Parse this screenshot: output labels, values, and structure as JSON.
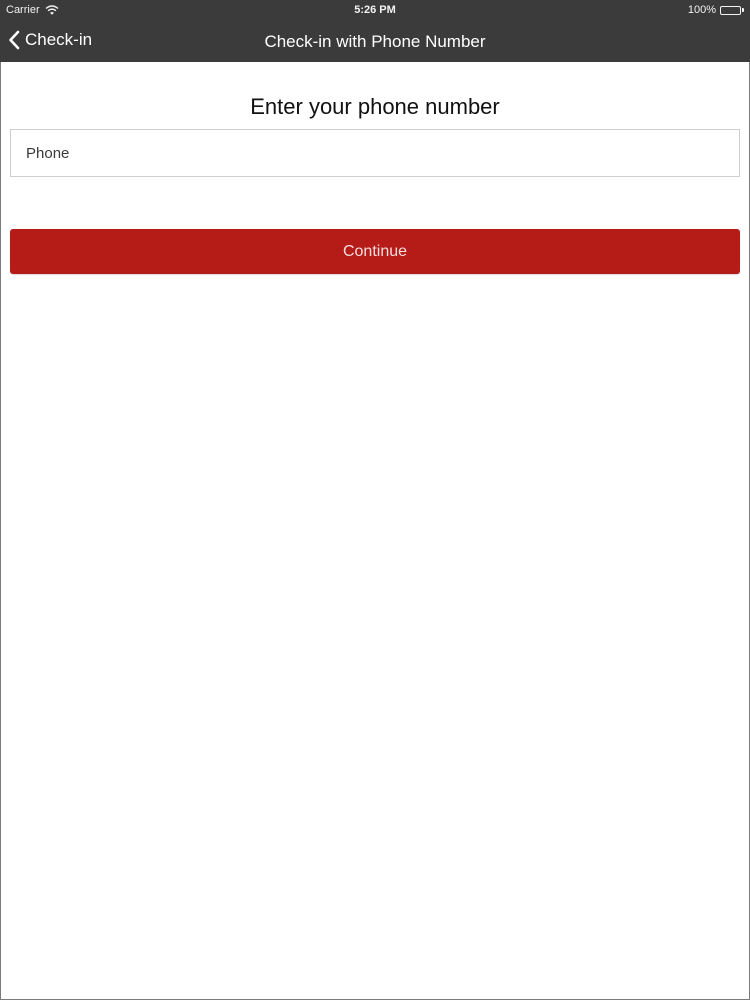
{
  "status_bar": {
    "carrier": "Carrier",
    "time": "5:26 PM",
    "battery": "100%",
    "battery_level": 1.0,
    "wifi_icon": "wifi-icon",
    "battery_icon": "battery-icon"
  },
  "nav": {
    "back_label": "Check-in",
    "back_icon": "chevron-left-icon",
    "title": "Check-in with Phone Number"
  },
  "main": {
    "heading": "Enter your phone number",
    "phone_placeholder": "Phone",
    "phone_value": "",
    "continue_label": "Continue"
  },
  "colors": {
    "nav_background": "#3b3b3b",
    "accent": "#b51b17"
  }
}
